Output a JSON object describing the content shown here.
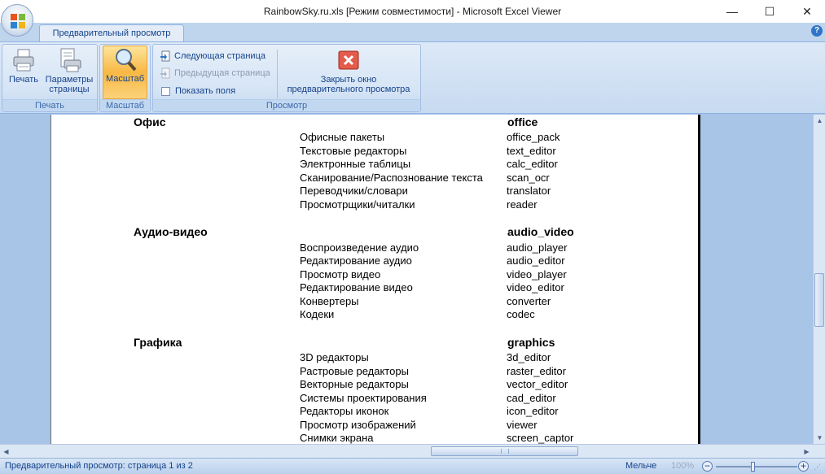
{
  "window": {
    "title": "RainbowSky.ru.xls  [Режим совместимости] - Microsoft Excel Viewer",
    "minimize": "—",
    "maximize": "☐",
    "close": "✕"
  },
  "tabs": {
    "active": "Предварительный просмотр",
    "help": "?"
  },
  "ribbon": {
    "print_group": {
      "label": "Печать",
      "print": "Печать",
      "page_setup_line1": "Параметры",
      "page_setup_line2": "страницы"
    },
    "zoom_group": {
      "label": "Масштаб",
      "zoom": "Масштаб"
    },
    "view_group": {
      "label": "Просмотр",
      "next_page": "Следующая страница",
      "prev_page": "Предыдущая страница",
      "show_margins": "Показать поля",
      "close_line1": "Закрыть окно",
      "close_line2": "предварительного просмотра"
    }
  },
  "sheet": {
    "categories": [
      {
        "ru": "Офис",
        "en": "office",
        "items": [
          {
            "ru": "Офисные пакеты",
            "en": "office_pack"
          },
          {
            "ru": "Текстовые редакторы",
            "en": "text_editor"
          },
          {
            "ru": "Электронные таблицы",
            "en": "calc_editor"
          },
          {
            "ru": "Сканирование/Распознование текста",
            "en": "scan_ocr"
          },
          {
            "ru": "Переводчики/словари",
            "en": "translator"
          },
          {
            "ru": "Просмотрщики/читалки",
            "en": "reader"
          }
        ]
      },
      {
        "ru": "Аудио-видео",
        "en": "audio_video",
        "items": [
          {
            "ru": "Воспроизведение аудио",
            "en": "audio_player"
          },
          {
            "ru": "Редактирование аудио",
            "en": "audio_editor"
          },
          {
            "ru": "Просмотр видео",
            "en": "video_player"
          },
          {
            "ru": "Редактирование видео",
            "en": "video_editor"
          },
          {
            "ru": "Конвертеры",
            "en": "converter"
          },
          {
            "ru": "Кодеки",
            "en": "codec"
          }
        ]
      },
      {
        "ru": "Графика",
        "en": "graphics",
        "items": [
          {
            "ru": "3D редакторы",
            "en": "3d_editor"
          },
          {
            "ru": "Растровые редакторы",
            "en": "raster_editor"
          },
          {
            "ru": "Векторные редакторы",
            "en": "vector_editor"
          },
          {
            "ru": "Системы проектирования",
            "en": "cad_editor"
          },
          {
            "ru": "Редакторы иконок",
            "en": "icon_editor"
          },
          {
            "ru": "Просмотр изображений",
            "en": "viewer"
          },
          {
            "ru": "Снимки экрана",
            "en": "screen_captor"
          }
        ]
      }
    ]
  },
  "statusbar": {
    "text": "Предварительный просмотр: страница 1 из 2",
    "zoom_out": "Мельче",
    "zoom_percent": "100%",
    "minus": "−",
    "plus": "+"
  }
}
